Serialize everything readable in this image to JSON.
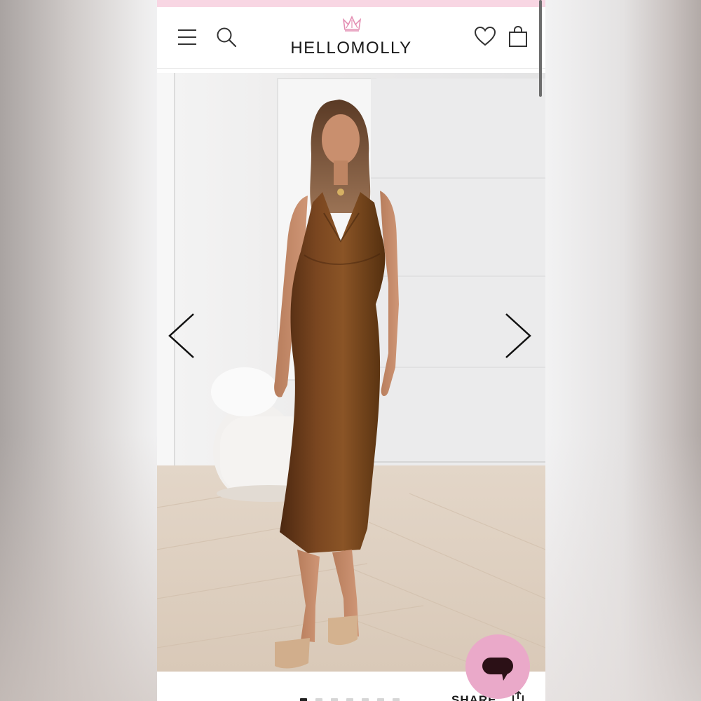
{
  "header": {
    "logo_text": "HELLOMOLLY",
    "icons": [
      "menu-icon",
      "search-icon",
      "heart-icon",
      "bag-icon"
    ]
  },
  "gallery": {
    "prev_icon": "chevron-left-icon",
    "next_icon": "chevron-right-icon",
    "slide_count": 7,
    "active_slide": 1
  },
  "footer": {
    "share_label": "SHARE",
    "share_icon": "share-icon"
  },
  "colors": {
    "promo_strip": "#f8d6e3",
    "chat_bubble": "#eaa9c9",
    "logo_crown": "#e48fb3",
    "dress": "#6e3d1b"
  }
}
